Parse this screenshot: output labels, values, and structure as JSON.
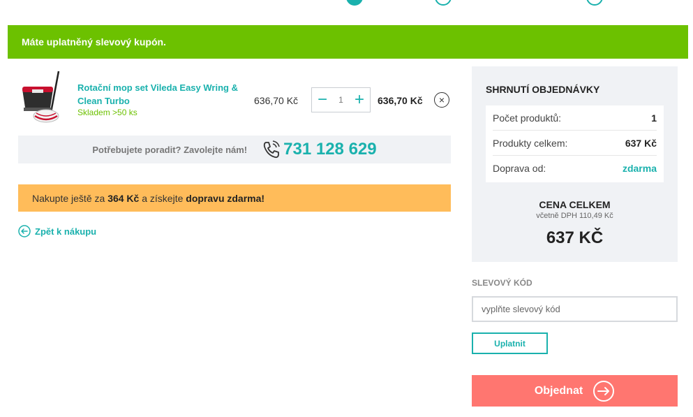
{
  "alert": {
    "message": "Máte uplatněný slevový kupón."
  },
  "cart": {
    "items": [
      {
        "name": "Rotační mop set Vileda Easy Wring & Clean Turbo",
        "stock": "Skladem >50 ks",
        "unit_price": "636,70 Kč",
        "quantity": "1",
        "minus": "−",
        "plus": "+",
        "total": "636,70 Kč",
        "remove_icon": "×"
      }
    ]
  },
  "help": {
    "text": "Potřebujete poradit? Zavolejte nám!",
    "phone": "731 128 629"
  },
  "shipping": {
    "prefix": "Nakupte ještě za ",
    "amount": "364 Kč",
    "middle": " a získejte ",
    "highlight": "dopravu zdarma",
    "suffix": "!"
  },
  "back": {
    "label": "Zpět k nákupu"
  },
  "summary": {
    "title": "SHRNUTÍ OBJEDNÁVKY",
    "rows": [
      {
        "label": "Počet produktů:",
        "value": "1"
      },
      {
        "label": "Produkty celkem:",
        "value": "637 Kč"
      },
      {
        "label": "Doprava od:",
        "value": "zdarma"
      }
    ],
    "total_label": "CENA CELKEM",
    "total_vat": "včetně DPH 110,49 Kč",
    "total_amount": "637 KČ"
  },
  "discount": {
    "label": "SLEVOVÝ KÓD",
    "placeholder": "vyplňte slevový kód",
    "apply": "Uplatnit"
  },
  "order": {
    "label": "Objednat"
  },
  "colors": {
    "accent": "#1ab1ad",
    "success": "#6cc100",
    "warning": "#ffbc5a",
    "cta": "#ff7670",
    "panel": "#f0f2f5"
  }
}
